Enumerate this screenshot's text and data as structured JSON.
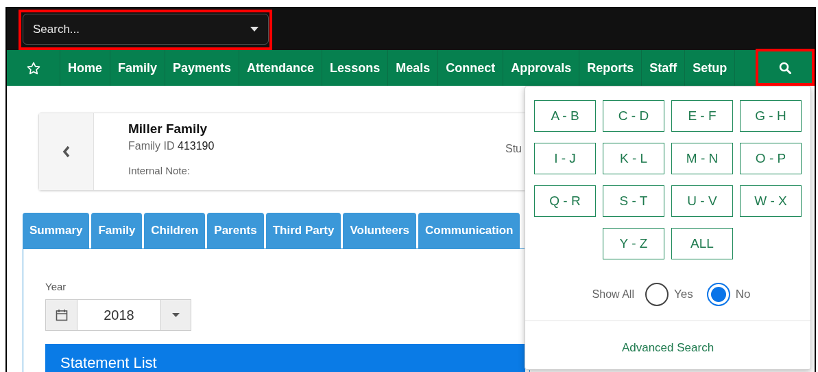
{
  "search": {
    "placeholder": "Search..."
  },
  "nav": {
    "items": [
      {
        "label": "Home"
      },
      {
        "label": "Family"
      },
      {
        "label": "Payments"
      },
      {
        "label": "Attendance"
      },
      {
        "label": "Lessons"
      },
      {
        "label": "Meals"
      },
      {
        "label": "Connect"
      },
      {
        "label": "Approvals"
      },
      {
        "label": "Reports"
      },
      {
        "label": "Staff"
      },
      {
        "label": "Setup"
      }
    ]
  },
  "family_card": {
    "name": "Miller Family",
    "id_label": "Family ID",
    "id_value": "413190",
    "note_label": "Internal Note:",
    "side_label": "Stu"
  },
  "tabs": [
    {
      "label": "Summary"
    },
    {
      "label": "Family"
    },
    {
      "label": "Children"
    },
    {
      "label": "Parents"
    },
    {
      "label": "Third Party"
    },
    {
      "label": "Volunteers"
    },
    {
      "label": "Communication"
    }
  ],
  "year_picker": {
    "label": "Year",
    "value": "2018"
  },
  "section_title": "Statement List",
  "search_popup": {
    "ranges": [
      "A - B",
      "C - D",
      "E - F",
      "G - H",
      "I - J",
      "K - L",
      "M - N",
      "O - P",
      "Q - R",
      "S - T",
      "U - V",
      "W - X",
      "Y - Z",
      "ALL"
    ],
    "show_all": {
      "label": "Show All",
      "options": [
        {
          "label": "Yes",
          "selected": false
        },
        {
          "label": "No",
          "selected": true
        }
      ]
    },
    "advanced_link": "Advanced Search"
  }
}
